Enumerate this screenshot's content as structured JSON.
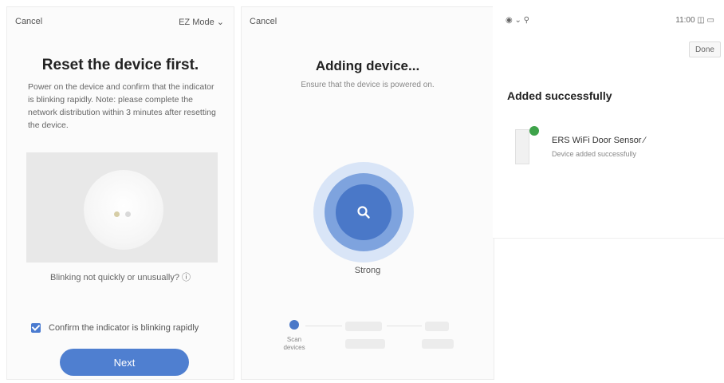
{
  "panel1": {
    "cancel_label": "Cancel",
    "mode_label": "EZ Mode ⌄",
    "title": "Reset the device first.",
    "description": "Power on the device and confirm that the indicator is blinking rapidly. Note: please complete the network distribution within 3 minutes after resetting the device.",
    "help_link": "Blinking not quickly or unusually? ⓘ",
    "confirm_label": "Confirm the indicator is blinking rapidly",
    "next_label": "Next"
  },
  "panel2": {
    "cancel_label": "Cancel",
    "title": "Adding device...",
    "subtitle": "Ensure that the device is powered on.",
    "status_text": "Strong",
    "steps": [
      {
        "label": "Scan devices"
      }
    ]
  },
  "panel3": {
    "status_left": "◉ ⌄ ⚲",
    "status_right": "11:00 ◫ ▭",
    "done_label": "Done",
    "title": "Added successfully",
    "device_name": "ERS WiFi Door Sensor ∕",
    "device_sub": "Device added successfully"
  },
  "colors": {
    "accent": "#4a78c8",
    "success": "#3ea34a"
  },
  "icons": {
    "search": "search-icon",
    "check": "check-icon"
  }
}
